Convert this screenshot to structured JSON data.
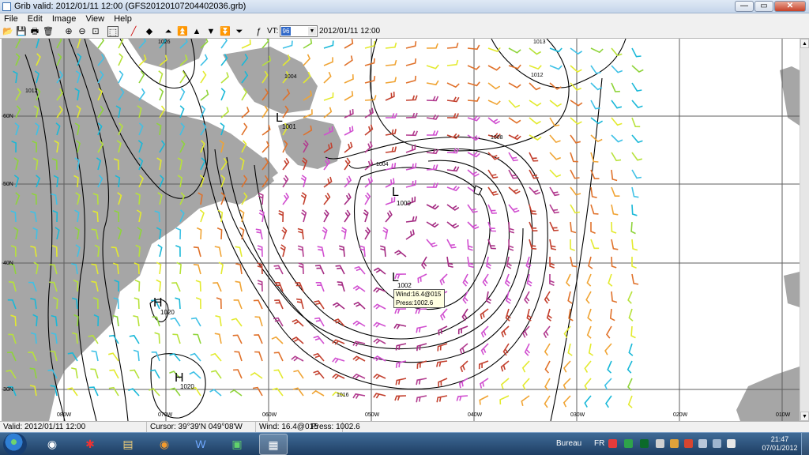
{
  "window": {
    "title": "Grib valid: 2012/01/11 12:00 (GFS20120107204402036.grb)",
    "buttons": [
      "minimize",
      "maximize",
      "close"
    ]
  },
  "menu": [
    "File",
    "Edit",
    "Image",
    "View",
    "Help"
  ],
  "toolbar": {
    "icons": [
      "open-folder-icon",
      "save-icon",
      "print-icon",
      "trash-icon",
      "zoom-in-icon",
      "zoom-out-icon",
      "zoom-fit-icon",
      "select-area-icon",
      "pencil-red-icon",
      "diamond-icon",
      "up-bar-icon",
      "up-double-icon",
      "up-icon",
      "down-icon",
      "down-double-icon",
      "down-bar-icon",
      "formula-icon"
    ],
    "vt_label": "VT:",
    "vt_value": "96",
    "date": "2012/01/11 12:00"
  },
  "map": {
    "lat_labels": [
      "60N",
      "50N",
      "40N",
      "30N"
    ],
    "lon_labels": [
      "080W",
      "070W",
      "060W",
      "050W",
      "040W",
      "030W",
      "020W",
      "010W"
    ],
    "pressure_centers": [
      {
        "type": "L",
        "value": "1001"
      },
      {
        "type": "L",
        "value": "1000"
      },
      {
        "type": "L",
        "value": "1002"
      },
      {
        "type": "H",
        "value": "1020"
      },
      {
        "type": "H",
        "value": "1020"
      }
    ],
    "isobar_labels": [
      "1026",
      "1013",
      "1012",
      "1012",
      "1004",
      "1004",
      "1008",
      "1016"
    ],
    "tooltip": {
      "wind": "Wind:16.4@015",
      "press": "Press:1002.6"
    }
  },
  "status": {
    "valid": "Valid: 2012/01/11 12:00",
    "cursor": "Cursor: 39°39'N  049°08'W",
    "wind": "Wind: 16.4@015",
    "press": "Press: 1002.6"
  },
  "taskbar": {
    "tasks": [
      "firefox-icon",
      "red-app-icon",
      "explorer-icon",
      "firefox-icon",
      "word-icon",
      "green-app-icon",
      "grib-viewer-icon"
    ],
    "desktop_label": "Bureau",
    "lang": "FR",
    "time": "21:47",
    "date": "07/01/2012"
  },
  "colors": {
    "land": "#a6a6a6",
    "grid": "#5f5f5f",
    "isobar": "#000000",
    "wind_colors": [
      "#3fc1e6",
      "#19b8d8",
      "#8fd43b",
      "#b7e23a",
      "#e3ea2e",
      "#f0a434",
      "#e0712a",
      "#c3402e",
      "#b23b8f",
      "#d14fd0",
      "#a42a82"
    ]
  }
}
